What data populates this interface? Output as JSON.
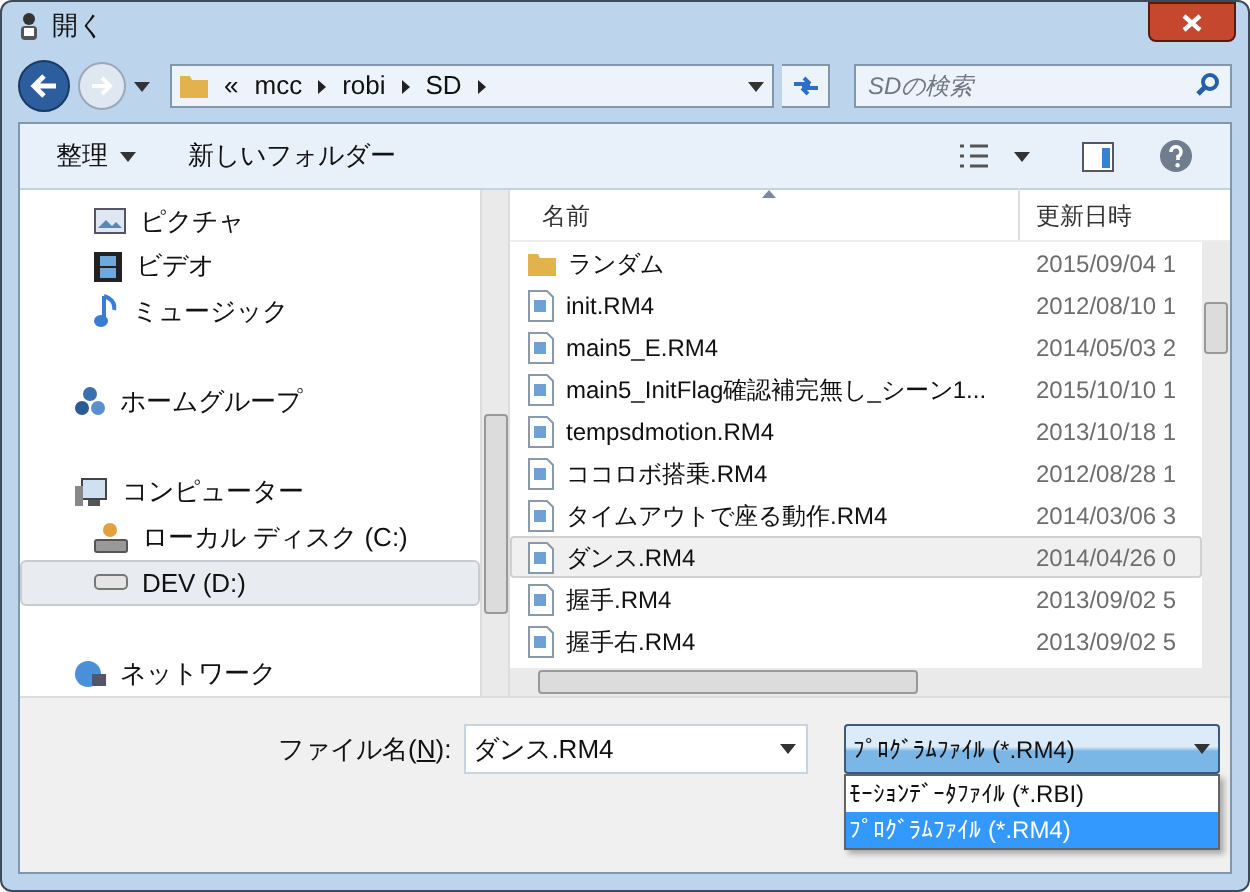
{
  "window": {
    "title": "開く"
  },
  "nav": {
    "overflow": "«",
    "path": [
      "mcc",
      "robi",
      "SD"
    ],
    "search_placeholder": "SDの検索"
  },
  "toolbar": {
    "organize": "整理",
    "new_folder": "新しいフォルダー"
  },
  "sidebar": {
    "items": [
      {
        "children": [
          {
            "label": "ピクチャ",
            "selected": false
          },
          {
            "label": "ビデオ",
            "selected": false
          },
          {
            "label": "ミュージック",
            "selected": false
          }
        ]
      },
      {
        "label": "ホームグループ",
        "selected": false
      },
      {
        "label": "コンピューター",
        "selected": false,
        "children": [
          {
            "label": "ローカル ディスク (C:)",
            "selected": false
          },
          {
            "label": "DEV (D:)",
            "selected": true
          }
        ]
      },
      {
        "label": "ネットワーク",
        "selected": false
      }
    ]
  },
  "files": {
    "columns": [
      "名前",
      "更新日時"
    ],
    "rows": [
      {
        "kind": "folder",
        "name": "ランダム",
        "date": "2015/09/04 1",
        "selected": false
      },
      {
        "kind": "file",
        "name": "init.RM4",
        "date": "2012/08/10 1",
        "selected": false
      },
      {
        "kind": "file",
        "name": "main5_E.RM4",
        "date": "2014/05/03 2",
        "selected": false
      },
      {
        "kind": "file",
        "name": "main5_InitFlag確認補完無し_シーン1...",
        "date": "2015/10/10 1",
        "selected": false
      },
      {
        "kind": "file",
        "name": "tempsdmotion.RM4",
        "date": "2013/10/18 1",
        "selected": false
      },
      {
        "kind": "file",
        "name": "ココロボ搭乗.RM4",
        "date": "2012/08/28 1",
        "selected": false
      },
      {
        "kind": "file",
        "name": "タイムアウトで座る動作.RM4",
        "date": "2014/03/06 3",
        "selected": false
      },
      {
        "kind": "file",
        "name": "ダンス.RM4",
        "date": "2014/04/26 0",
        "selected": true
      },
      {
        "kind": "file",
        "name": "握手.RM4",
        "date": "2013/09/02 5",
        "selected": false
      },
      {
        "kind": "file",
        "name": "握手右.RM4",
        "date": "2013/09/02 5",
        "selected": false
      }
    ]
  },
  "filename": {
    "label_before": "ファイル名(",
    "accelerator": "N",
    "label_after": "):",
    "value": "ダンス.RM4"
  },
  "filter": {
    "value": "ﾌﾟﾛｸﾞﾗﾑﾌｧｲﾙ (*.RM4)",
    "expanded": true,
    "options": [
      {
        "label": "ﾓｰｼｮﾝﾃﾞｰﾀﾌｧｲﾙ (*.RBI)",
        "selected": false
      },
      {
        "label": "ﾌﾟﾛｸﾞﾗﾑﾌｧｲﾙ (*.RM4)",
        "selected": true
      }
    ]
  }
}
